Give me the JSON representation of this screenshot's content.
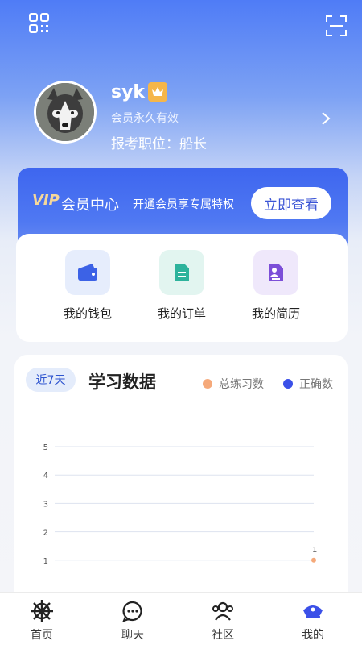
{
  "profile": {
    "username": "syk",
    "member_status": "会员永久有效",
    "position": "报考职位：船长"
  },
  "vip": {
    "logo": "VIP",
    "title": "会员中心",
    "description": "开通会员享专属特权",
    "button": "立即查看"
  },
  "services": [
    {
      "label": "我的钱包",
      "icon": "wallet-icon",
      "color": "#3c62e6"
    },
    {
      "label": "我的订单",
      "icon": "order-document-icon",
      "color": "#2db39c"
    },
    {
      "label": "我的简历",
      "icon": "resume-icon",
      "color": "#7c4fd8"
    }
  ],
  "stats": {
    "range": "近7天",
    "title": "学习数据",
    "legend": [
      {
        "name": "总练习数",
        "color": "#f5a97a"
      },
      {
        "name": "正确数",
        "color": "#3b50e8"
      }
    ]
  },
  "chart_data": {
    "type": "line",
    "y_ticks": [
      "5",
      "4",
      "3",
      "2",
      "1"
    ],
    "ylim": [
      0,
      5
    ],
    "series": [
      {
        "name": "总练习数",
        "color": "#f5a97a",
        "last_label": "1"
      },
      {
        "name": "正确数",
        "color": "#3b50e8"
      }
    ],
    "grid": true
  },
  "tabs": [
    {
      "label": "首页",
      "icon": "helm-icon"
    },
    {
      "label": "聊天",
      "icon": "chat-icon"
    },
    {
      "label": "社区",
      "icon": "community-icon"
    },
    {
      "label": "我的",
      "icon": "profile-cap-icon"
    }
  ]
}
